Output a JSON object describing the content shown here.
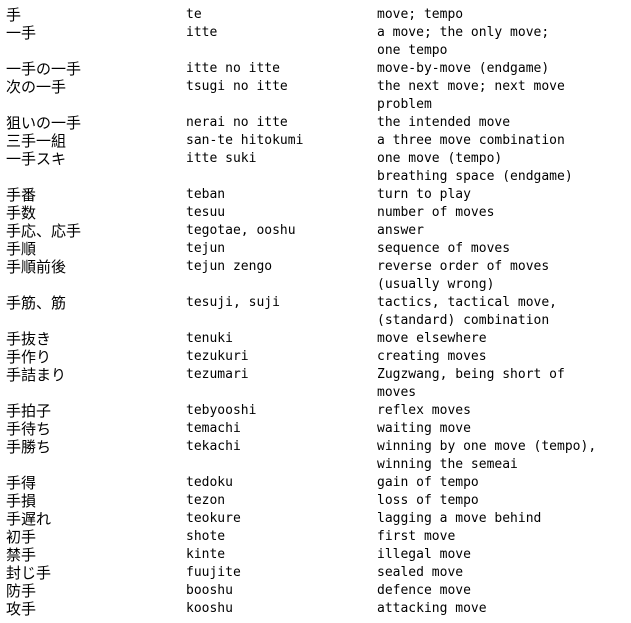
{
  "glossary": {
    "rows": [
      {
        "japanese": "手",
        "romaji": "te",
        "english": [
          "move; tempo"
        ]
      },
      {
        "japanese": "一手",
        "romaji": "itte",
        "english": [
          "a move; the only move;",
          "one tempo"
        ]
      },
      {
        "japanese": "一手の一手",
        "romaji": "itte no itte",
        "english": [
          "move-by-move (endgame)"
        ]
      },
      {
        "japanese": "次の一手",
        "romaji": "tsugi no itte",
        "english": [
          "the next move; next move",
          "problem"
        ]
      },
      {
        "japanese": "狙いの一手",
        "romaji": "nerai no itte",
        "english": [
          "the intended move"
        ]
      },
      {
        "japanese": "三手一組",
        "romaji": "san-te hitokumi",
        "english": [
          "a three move combination"
        ]
      },
      {
        "japanese": "一手スキ",
        "romaji": "itte suki",
        "english": [
          "one move (tempo)",
          "breathing space (endgame)"
        ]
      },
      {
        "japanese": "手番",
        "romaji": "teban",
        "english": [
          "turn to play"
        ]
      },
      {
        "japanese": "手数",
        "romaji": "tesuu",
        "english": [
          "number of moves"
        ]
      },
      {
        "japanese": "手応、応手",
        "romaji": "tegotae, ooshu",
        "english": [
          "answer"
        ]
      },
      {
        "japanese": "手順",
        "romaji": "tejun",
        "english": [
          "sequence of moves"
        ]
      },
      {
        "japanese": "手順前後",
        "romaji": "tejun zengo",
        "english": [
          "reverse order of moves",
          "(usually wrong)"
        ]
      },
      {
        "japanese": "手筋、筋",
        "romaji": "tesuji, suji",
        "english": [
          "tactics, tactical move,",
          "(standard) combination"
        ]
      },
      {
        "japanese": "手抜き",
        "romaji": "tenuki",
        "english": [
          "move elsewhere"
        ]
      },
      {
        "japanese": "手作り",
        "romaji": "tezukuri",
        "english": [
          "creating moves"
        ]
      },
      {
        "japanese": "手詰まり",
        "romaji": "tezumari",
        "english": [
          "Zugzwang, being short of",
          "moves"
        ]
      },
      {
        "japanese": "手拍子",
        "romaji": "tebyooshi",
        "english": [
          "reflex moves"
        ]
      },
      {
        "japanese": "手待ち",
        "romaji": "temachi",
        "english": [
          "waiting move"
        ]
      },
      {
        "japanese": "手勝ち",
        "romaji": "tekachi",
        "english": [
          "winning by one move (tempo),",
          "winning the semeai"
        ]
      },
      {
        "japanese": "手得",
        "romaji": "tedoku",
        "english": [
          "gain of tempo"
        ]
      },
      {
        "japanese": "手損",
        "romaji": "tezon",
        "english": [
          "loss of tempo"
        ]
      },
      {
        "japanese": "手遅れ",
        "romaji": "teokure",
        "english": [
          "lagging a move behind"
        ]
      },
      {
        "japanese": "初手",
        "romaji": "shote",
        "english": [
          "first move"
        ]
      },
      {
        "japanese": "禁手",
        "romaji": "kinte",
        "english": [
          "illegal move"
        ]
      },
      {
        "japanese": "封じ手",
        "romaji": "fuujite",
        "english": [
          "sealed move"
        ]
      },
      {
        "japanese": "防手",
        "romaji": "booshu",
        "english": [
          "defence move"
        ]
      },
      {
        "japanese": "攻手",
        "romaji": "kooshu",
        "english": [
          "attacking move"
        ]
      }
    ]
  }
}
